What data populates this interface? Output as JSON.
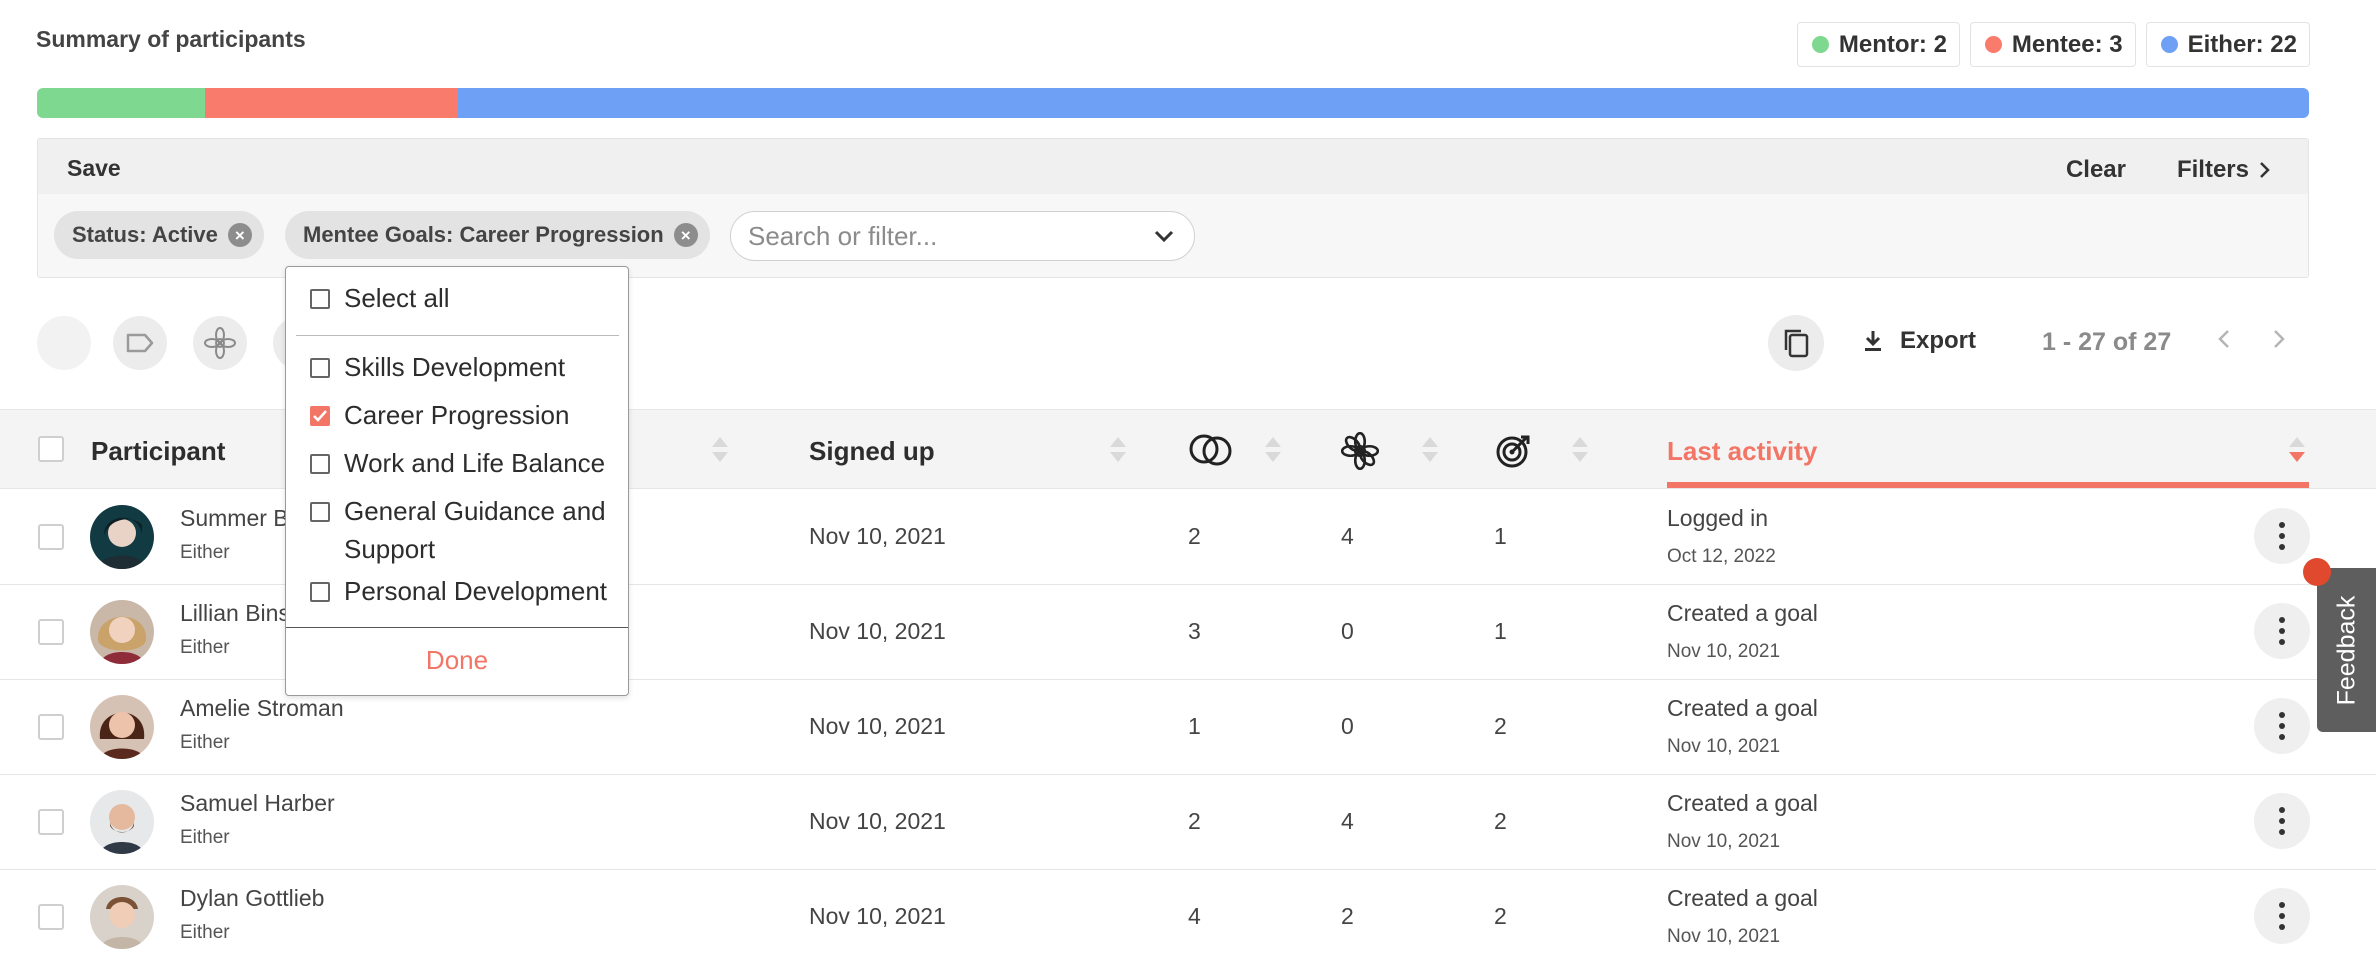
{
  "summary": {
    "title": "Summary of participants",
    "legend": [
      {
        "label": "Mentor: 2",
        "color": "#7fd88f"
      },
      {
        "label": "Mentee: 3",
        "color": "#f97b6b"
      },
      {
        "label": "Either: 22",
        "color": "#6ea0f5"
      }
    ],
    "distribution": [
      {
        "role": "Mentor",
        "count": 2,
        "color": "#7fd88f"
      },
      {
        "role": "Mentee",
        "count": 3,
        "color": "#f97b6b"
      },
      {
        "role": "Either",
        "count": 22,
        "color": "#6ea0f5"
      }
    ]
  },
  "filters": {
    "save_label": "Save",
    "clear_label": "Clear",
    "filters_label": "Filters",
    "chips": [
      "Status: Active",
      "Mentee Goals: Career Progression"
    ],
    "search_placeholder": "Search or filter..."
  },
  "dropdown": {
    "select_all": "Select all",
    "options": [
      {
        "label": "Skills Development",
        "checked": false
      },
      {
        "label": "Career Progression",
        "checked": true
      },
      {
        "label": "Work and Life Balance",
        "checked": false
      },
      {
        "label": "General Guidance and Support",
        "checked": false
      },
      {
        "label": "Personal Development",
        "checked": false
      }
    ],
    "done_label": "Done"
  },
  "toolbar": {
    "export_label": "Export",
    "pagination": "1 - 27 of 27"
  },
  "table": {
    "headers": {
      "participant": "Participant",
      "signed_up": "Signed up",
      "last_activity": "Last activity"
    },
    "rows": [
      {
        "name": "Summer B",
        "role": "Either",
        "signed_up": "Nov 10, 2021",
        "c1": "2",
        "c2": "4",
        "c3": "1",
        "activity": "Logged in",
        "activity_date": "Oct 12, 2022"
      },
      {
        "name": "Lillian Bins",
        "role": "Either",
        "signed_up": "Nov 10, 2021",
        "c1": "3",
        "c2": "0",
        "c3": "1",
        "activity": "Created a goal",
        "activity_date": "Nov 10, 2021"
      },
      {
        "name": "Amelie Stroman",
        "role": "Either",
        "signed_up": "Nov 10, 2021",
        "c1": "1",
        "c2": "0",
        "c3": "2",
        "activity": "Created a goal",
        "activity_date": "Nov 10, 2021"
      },
      {
        "name": "Samuel Harber",
        "role": "Either",
        "signed_up": "Nov 10, 2021",
        "c1": "2",
        "c2": "4",
        "c3": "2",
        "activity": "Created a goal",
        "activity_date": "Nov 10, 2021"
      },
      {
        "name": "Dylan Gottlieb",
        "role": "Either",
        "signed_up": "Nov 10, 2021",
        "c1": "4",
        "c2": "2",
        "c3": "2",
        "activity": "Created a goal",
        "activity_date": "Nov 10, 2021"
      }
    ]
  },
  "feedback": {
    "label": "Feedback"
  },
  "colors": {
    "accent": "#f27565",
    "mentor": "#7fd88f",
    "mentee": "#f97b6b",
    "either": "#6ea0f5"
  }
}
